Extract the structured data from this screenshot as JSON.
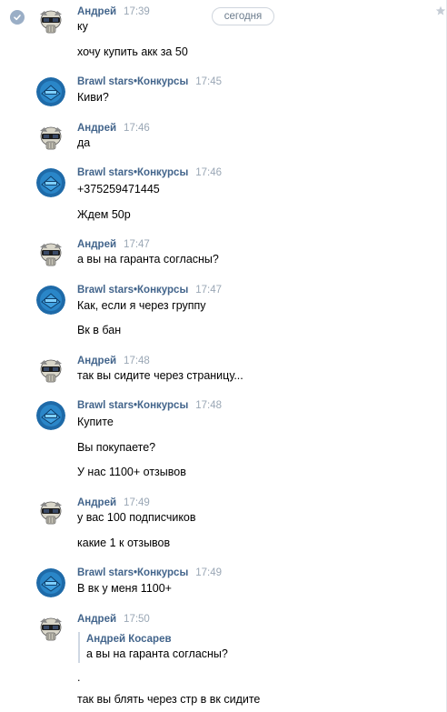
{
  "date_divider": "сегодня",
  "messages": [
    {
      "author": "Андрей",
      "time": "17:39",
      "avatar": "skull-avatar",
      "lines": [
        "ку",
        "хочу купить акк за 50"
      ]
    },
    {
      "author": "Brawl stars•Конкурсы",
      "time": "17:45",
      "avatar": "brawl-avatar",
      "lines": [
        "Киви?"
      ]
    },
    {
      "author": "Андрей",
      "time": "17:46",
      "avatar": "skull-avatar",
      "lines": [
        "да"
      ]
    },
    {
      "author": "Brawl stars•Конкурсы",
      "time": "17:46",
      "avatar": "brawl-avatar",
      "lines": [
        "+375259471445",
        "Ждем 50р"
      ]
    },
    {
      "author": "Андрей",
      "time": "17:47",
      "avatar": "skull-avatar",
      "lines": [
        "а вы на гаранта согласны?"
      ]
    },
    {
      "author": "Brawl stars•Конкурсы",
      "time": "17:47",
      "avatar": "brawl-avatar",
      "lines": [
        "Как, если я через группу",
        "Вк в бан"
      ]
    },
    {
      "author": "Андрей",
      "time": "17:48",
      "avatar": "skull-avatar",
      "lines": [
        "так вы сидите через страницу..."
      ]
    },
    {
      "author": "Brawl stars•Конкурсы",
      "time": "17:48",
      "avatar": "brawl-avatar",
      "lines": [
        "Купите",
        "Вы покупаете?",
        "У нас 1100+ отзывов"
      ]
    },
    {
      "author": "Андрей",
      "time": "17:49",
      "avatar": "skull-avatar",
      "lines": [
        "у вас 100 подписчиков",
        "какие 1 к отзывов"
      ]
    },
    {
      "author": "Brawl stars•Конкурсы",
      "time": "17:49",
      "avatar": "brawl-avatar",
      "lines": [
        "В вк у меня 1100+"
      ]
    },
    {
      "author": "Андрей",
      "time": "17:50",
      "avatar": "skull-avatar",
      "lines": [
        ".",
        "так вы блять через стр в вк сидите"
      ]
    }
  ],
  "quote": {
    "author": "Андрей Косарев",
    "text": "а вы на гаранта согласны?"
  },
  "colors": {
    "author": "#42648b",
    "time": "#9aa7b5",
    "brawl_avatar_bg": "#1e6aa8"
  }
}
